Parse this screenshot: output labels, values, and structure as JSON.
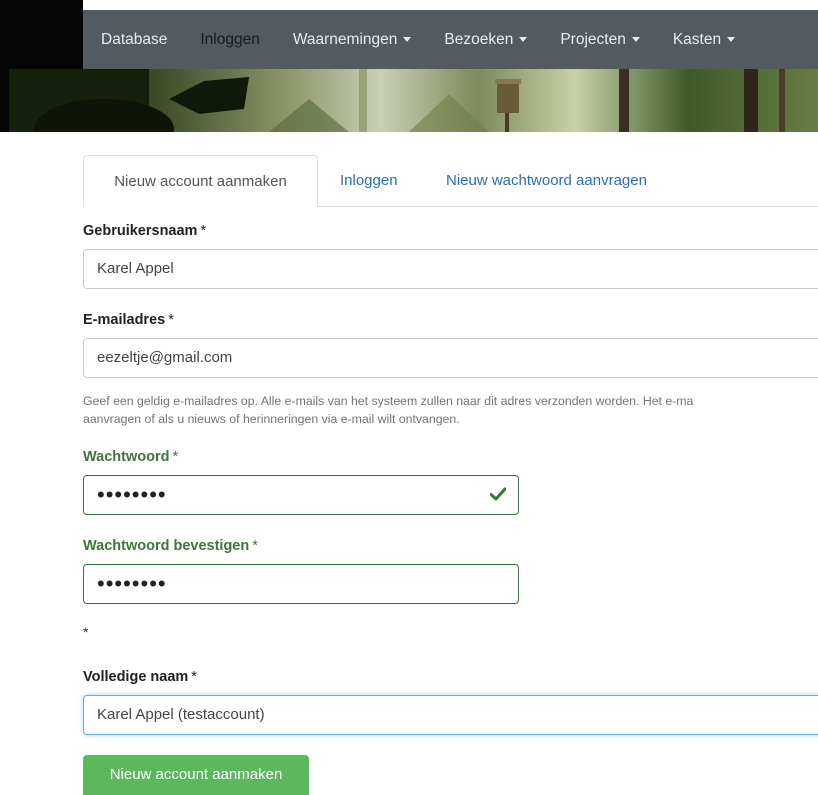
{
  "nav": {
    "items": [
      {
        "label": "Database",
        "caret": false,
        "active": false
      },
      {
        "label": "Inloggen",
        "caret": false,
        "active": true
      },
      {
        "label": "Waarnemingen",
        "caret": true,
        "active": false
      },
      {
        "label": "Bezoeken",
        "caret": true,
        "active": false
      },
      {
        "label": "Projecten",
        "caret": true,
        "active": false
      },
      {
        "label": "Kasten",
        "caret": true,
        "active": false
      }
    ]
  },
  "tabs": {
    "create": "Nieuw account aanmaken",
    "login": "Inloggen",
    "reset": "Nieuw wachtwoord aanvragen"
  },
  "form": {
    "username": {
      "label": "Gebruikersnaam",
      "required": "*",
      "value": "Karel Appel"
    },
    "email": {
      "label": "E-mailadres",
      "required": "*",
      "value": "eezeltje@gmail.com",
      "help_line1": "Geef een geldig e-mailadres op. Alle e-mails van het systeem zullen naar dit adres verzonden worden. Het e-ma",
      "help_line2": "aanvragen of als u nieuws of herinneringen via e-mail wilt ontvangen."
    },
    "password": {
      "label": "Wachtwoord",
      "required": "*",
      "value": "••••••••"
    },
    "password_confirm": {
      "label": "Wachtwoord bevestigen",
      "required": "*",
      "value": "••••••••"
    },
    "star_note": "*",
    "fullname": {
      "label": "Volledige naam",
      "required": "*",
      "value": "Karel Appel (testaccount)"
    },
    "submit_label": "Nieuw account aanmaken"
  },
  "colors": {
    "navbar": "#535b61",
    "link": "#2a6ebb",
    "success": "#3c763d",
    "button": "#5cb85c",
    "focus": "#66afe9"
  }
}
